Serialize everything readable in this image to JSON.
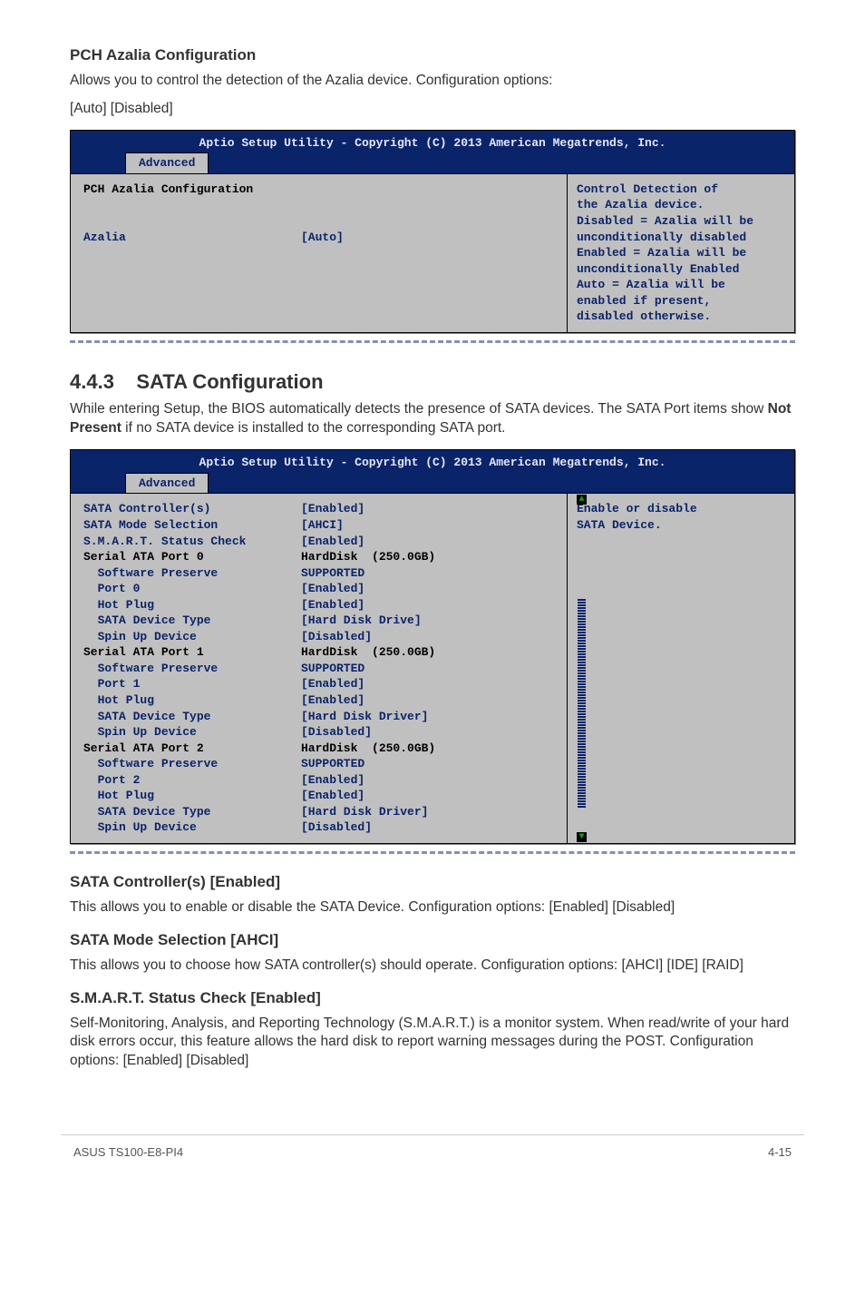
{
  "sections": {
    "pch_title": "PCH Azalia Configuration",
    "pch_desc1": "Allows you to control the detection of the Azalia device. Configuration options:",
    "pch_desc2": "[Auto] [Disabled]",
    "sata_section_num": "4.4.3",
    "sata_section_title": "SATA Configuration",
    "sata_intro_a": "While entering Setup, the BIOS automatically detects the presence of SATA devices. The SATA Port items show ",
    "sata_intro_bold": "Not Present",
    "sata_intro_b": " if no SATA device is installed to the corresponding SATA port.",
    "ctrl_title": "SATA Controller(s) [Enabled]",
    "ctrl_desc": "This allows you to enable or disable the SATA Device. Configuration options: [Enabled] [Disabled]",
    "mode_title": "SATA Mode Selection [AHCI]",
    "mode_desc": "This allows you to choose how SATA controller(s) should operate. Configuration options: [AHCI] [IDE] [RAID]",
    "smart_title": "S.M.A.R.T. Status Check [Enabled]",
    "smart_desc": "Self-Monitoring, Analysis, and Reporting Technology (S.M.A.R.T.) is a monitor system. When read/write of your hard disk errors occur, this feature allows the hard disk to report warning messages during the POST. Configuration options: [Enabled] [Disabled]"
  },
  "bios1": {
    "header": "Aptio Setup Utility - Copyright (C) 2013 American Megatrends, Inc.",
    "tab": "Advanced",
    "left_title": "PCH Azalia Configuration",
    "row1_label": "Azalia",
    "row1_value": "[Auto]",
    "help": "Control Detection of\nthe Azalia device.\nDisabled = Azalia will be\nunconditionally disabled\nEnabled = Azalia will be\nunconditionally Enabled\nAuto = Azalia will be\nenabled if present,\ndisabled otherwise."
  },
  "bios2": {
    "header": "Aptio Setup Utility - Copyright (C) 2013 American Megatrends, Inc.",
    "tab": "Advanced",
    "help": "Enable or disable\nSATA Device.",
    "rows": [
      {
        "l": "SATA Controller(s)",
        "v": "[Enabled]"
      },
      {
        "l": "SATA Mode Selection",
        "v": "[AHCI]"
      },
      {
        "l": "S.M.A.R.T. Status Check",
        "v": "[Enabled]"
      },
      {
        "l": "",
        "v": ""
      },
      {
        "l": "Serial ATA Port 0",
        "v": "HardDisk  (250.0GB)"
      },
      {
        "l": "  Software Preserve",
        "v": "SUPPORTED"
      },
      {
        "l": "  Port 0",
        "v": "[Enabled]"
      },
      {
        "l": "  Hot Plug",
        "v": "[Enabled]"
      },
      {
        "l": "  SATA Device Type",
        "v": "[Hard Disk Drive]"
      },
      {
        "l": "  Spin Up Device",
        "v": "[Disabled]"
      },
      {
        "l": "Serial ATA Port 1",
        "v": "HardDisk  (250.0GB)"
      },
      {
        "l": "  Software Preserve",
        "v": "SUPPORTED"
      },
      {
        "l": "  Port 1",
        "v": "[Enabled]"
      },
      {
        "l": "  Hot Plug",
        "v": "[Enabled]"
      },
      {
        "l": "  SATA Device Type",
        "v": "[Hard Disk Driver]"
      },
      {
        "l": "  Spin Up Device",
        "v": "[Disabled]"
      },
      {
        "l": "Serial ATA Port 2",
        "v": "HardDisk  (250.0GB)"
      },
      {
        "l": "  Software Preserve",
        "v": "SUPPORTED"
      },
      {
        "l": "  Port 2",
        "v": "[Enabled]"
      },
      {
        "l": "  Hot Plug",
        "v": "[Enabled]"
      },
      {
        "l": "  SATA Device Type",
        "v": "[Hard Disk Driver]"
      },
      {
        "l": "  Spin Up Device",
        "v": "[Disabled]"
      }
    ]
  },
  "footer": {
    "left": "ASUS TS100-E8-PI4",
    "right": "4-15"
  }
}
